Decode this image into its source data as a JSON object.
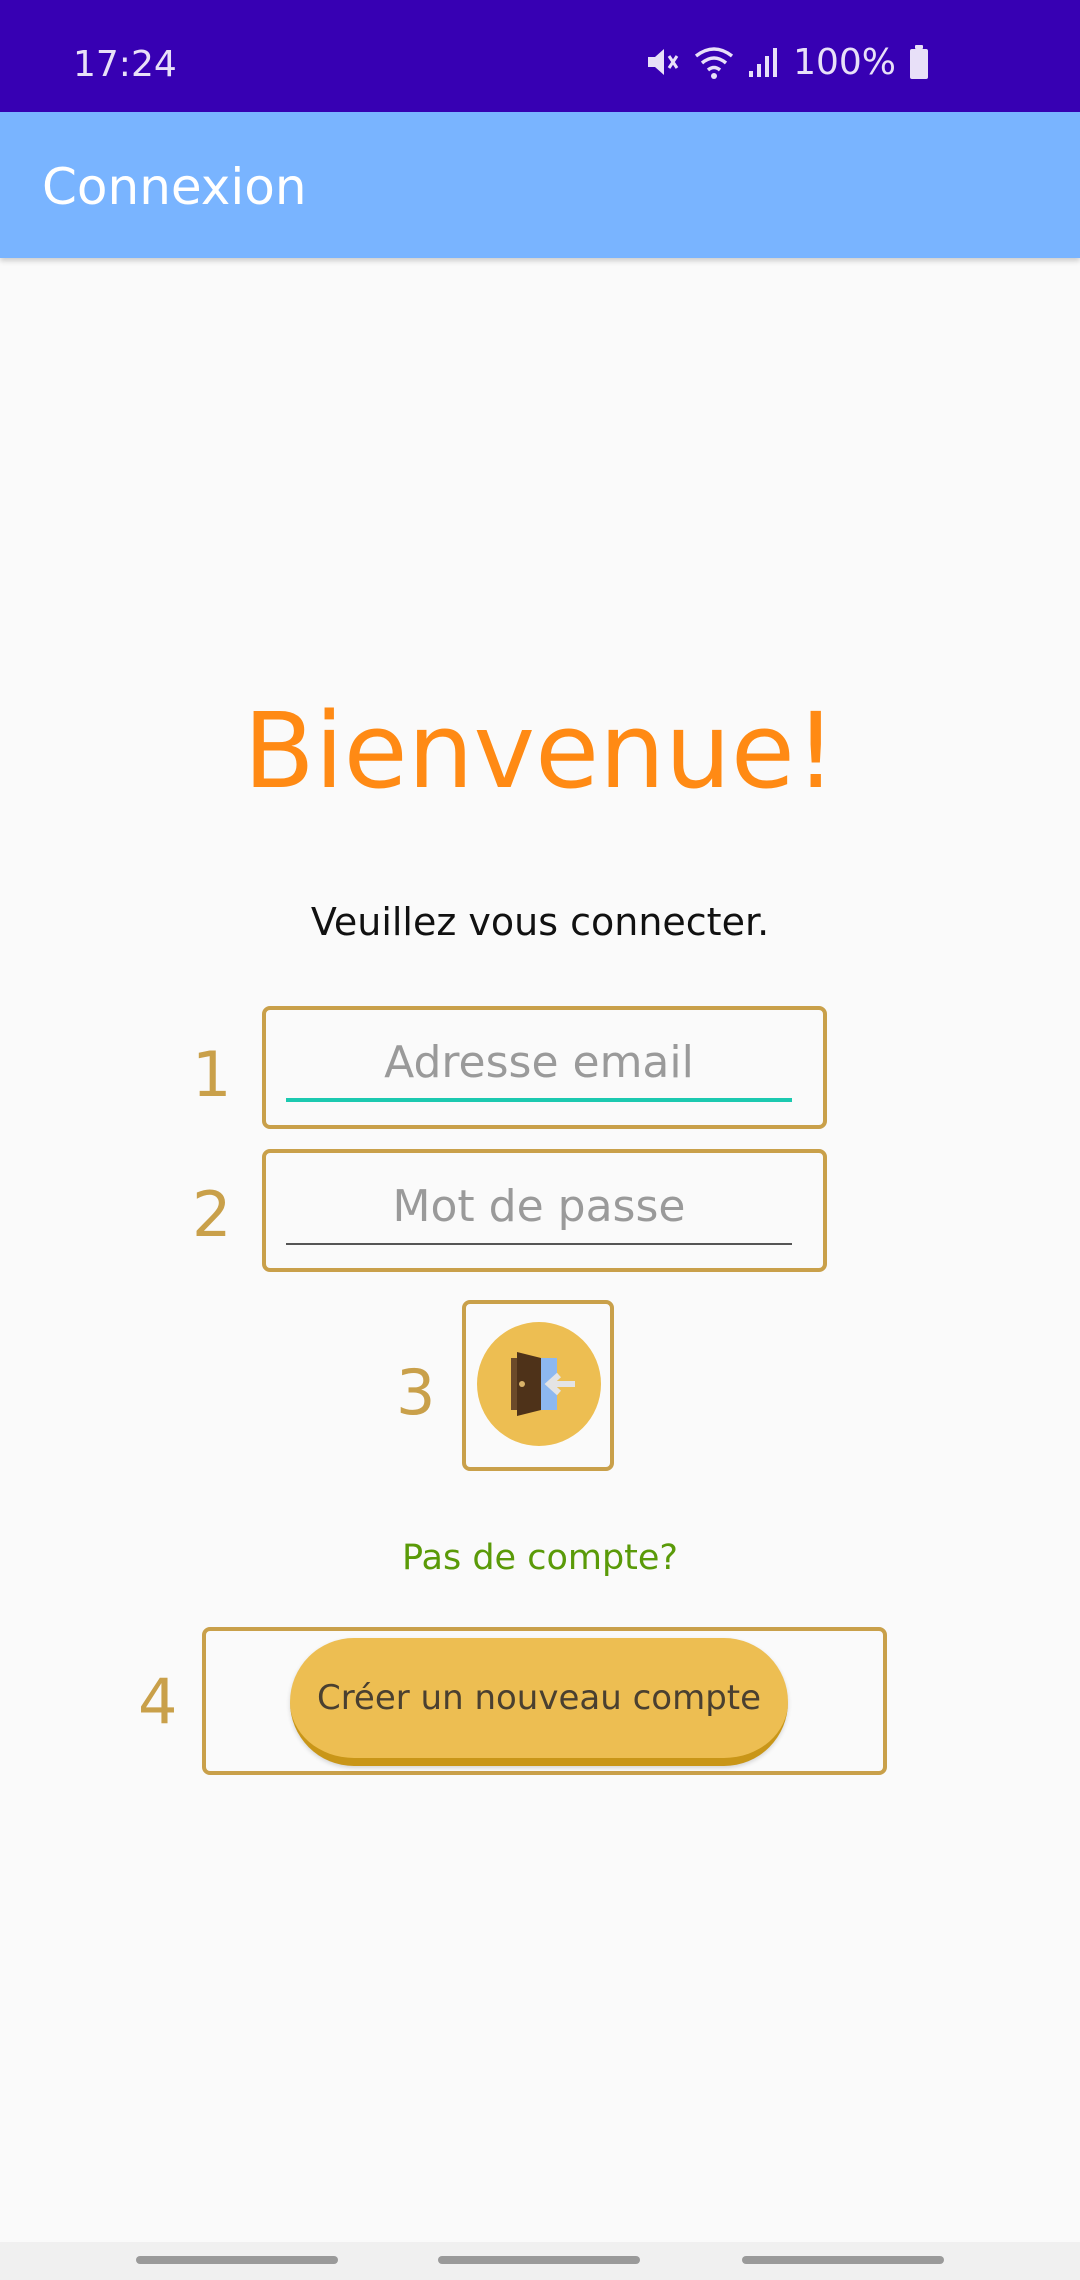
{
  "status_bar": {
    "time": "17:24",
    "battery": "100%",
    "icons": [
      "mute-icon",
      "wifi-icon",
      "signal-icon",
      "battery-icon"
    ]
  },
  "app_bar": {
    "title": "Connexion"
  },
  "login": {
    "welcome": "Bienvenue!",
    "subtitle": "Veuillez vous connecter.",
    "email_placeholder": "Adresse email",
    "email_value": "",
    "password_placeholder": "Mot de passe",
    "password_value": "",
    "login_icon": "door-enter-icon",
    "no_account": "Pas de compte?",
    "create_account": "Créer un nouveau compte"
  },
  "callouts": [
    "1",
    "2",
    "3",
    "4"
  ],
  "colors": {
    "status_bar": "#3700B3",
    "app_bar": "#79B4FF",
    "welcome": "#FF8A14",
    "callout": "#C9A04A",
    "button": "#EDBE52",
    "link": "#5A9A08",
    "email_underline": "#1CC9B0"
  }
}
